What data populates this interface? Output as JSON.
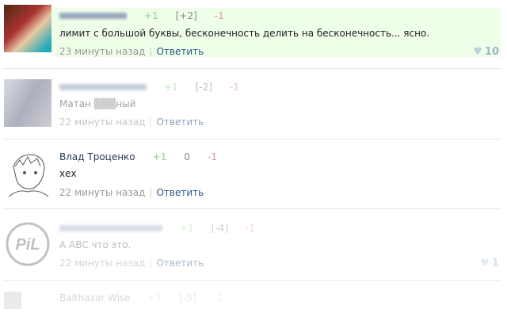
{
  "comments": [
    {
      "name": "",
      "votes": {
        "plus": "+1",
        "score": "[+2]",
        "minus": "-1"
      },
      "text": "лимит с большой буквы, бесконечность делить на бесконечность... ясно.",
      "time": "23 минуты назад",
      "sep": "|",
      "reply": "Ответить",
      "likes": "10"
    },
    {
      "name": "",
      "votes": {
        "plus": "+1",
        "score": "[-2]",
        "minus": "-1"
      },
      "text": "Матан ▒▒▒ный",
      "time": "22 минуты назад",
      "sep": "|",
      "reply": "Ответить"
    },
    {
      "name": "Влад Троценко",
      "votes": {
        "plus": "+1",
        "score": "0",
        "minus": "-1"
      },
      "text": "хех",
      "time": "22 минуты назад",
      "sep": "|",
      "reply": "Ответить"
    },
    {
      "name": "",
      "votes": {
        "plus": "+1",
        "score": "[-4]",
        "minus": "-1"
      },
      "text": "А ABC что это.",
      "time": "22 минуты назад",
      "sep": "|",
      "reply": "Ответить",
      "likes": "1",
      "avatar_logo": "PiL"
    },
    {
      "name": "Balthazar Wise",
      "votes": {
        "plus": "+1",
        "score": "[-5]",
        "minus": "-1"
      }
    }
  ],
  "colors": {
    "highlight": "#eefee9",
    "link": "#2a5885",
    "plus": "#8ccf8c",
    "minus": "#d89a9a"
  }
}
